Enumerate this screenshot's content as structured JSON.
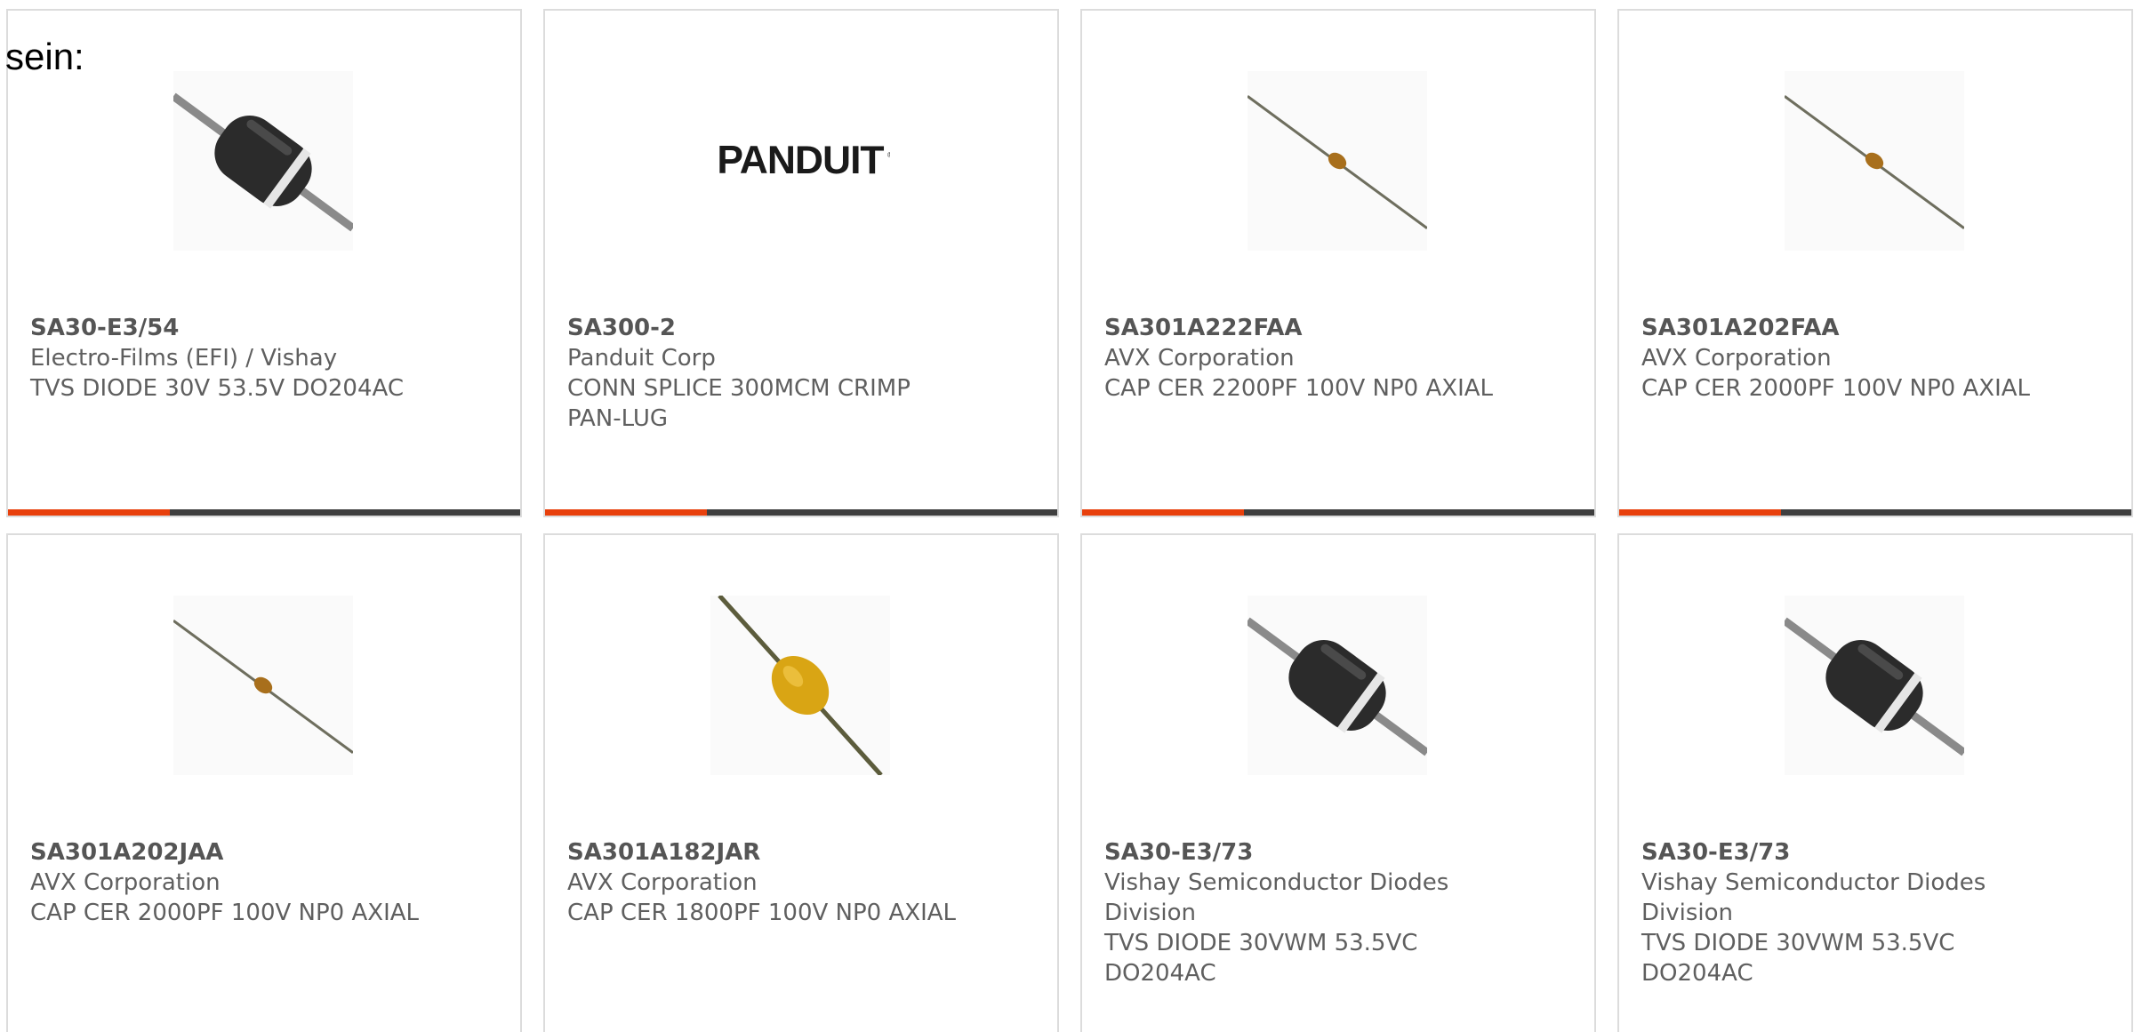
{
  "intro_text": "sein:",
  "accent_color": "#e8400c",
  "cards": [
    {
      "part_number": "SA30-E3/54",
      "manufacturer": "Electro-Films (EFI) / Vishay",
      "description_lines": [
        "TVS DIODE 30V 53.5V DO204AC"
      ],
      "image": "diode-black-icon"
    },
    {
      "part_number": "SA300-2",
      "manufacturer": "Panduit Corp",
      "description_lines": [
        "CONN SPLICE 300MCM CRIMP",
        "PAN-LUG"
      ],
      "image": "panduit-logo",
      "logo_text": "PANDUIT"
    },
    {
      "part_number": "SA301A222FAA",
      "manufacturer": "AVX Corporation",
      "description_lines": [
        "CAP CER 2200PF 100V NP0 AXIAL"
      ],
      "image": "capacitor-axial-small-icon"
    },
    {
      "part_number": "SA301A202FAA",
      "manufacturer": "AVX Corporation",
      "description_lines": [
        "CAP CER 2000PF 100V NP0 AXIAL"
      ],
      "image": "capacitor-axial-small-icon"
    },
    {
      "part_number": "SA301A202JAA",
      "manufacturer": "AVX Corporation",
      "description_lines": [
        "CAP CER 2000PF 100V NP0 AXIAL"
      ],
      "image": "capacitor-axial-small-icon"
    },
    {
      "part_number": "SA301A182JAR",
      "manufacturer": "AVX Corporation",
      "description_lines": [
        "CAP CER 1800PF 100V NP0 AXIAL"
      ],
      "image": "capacitor-axial-large-icon"
    },
    {
      "part_number": "SA30-E3/73",
      "manufacturer": "Vishay Semiconductor Diodes Division",
      "manufacturer_lines": [
        "Vishay Semiconductor Diodes",
        "Division"
      ],
      "description_lines": [
        "TVS DIODE 30VWM 53.5VC",
        "DO204AC"
      ],
      "image": "diode-black-icon"
    },
    {
      "part_number": "SA30-E3/73",
      "manufacturer": "Vishay Semiconductor Diodes Division",
      "manufacturer_lines": [
        "Vishay Semiconductor Diodes",
        "Division"
      ],
      "description_lines": [
        "TVS DIODE 30VWM 53.5VC",
        "DO204AC"
      ],
      "image": "diode-black-icon"
    }
  ]
}
